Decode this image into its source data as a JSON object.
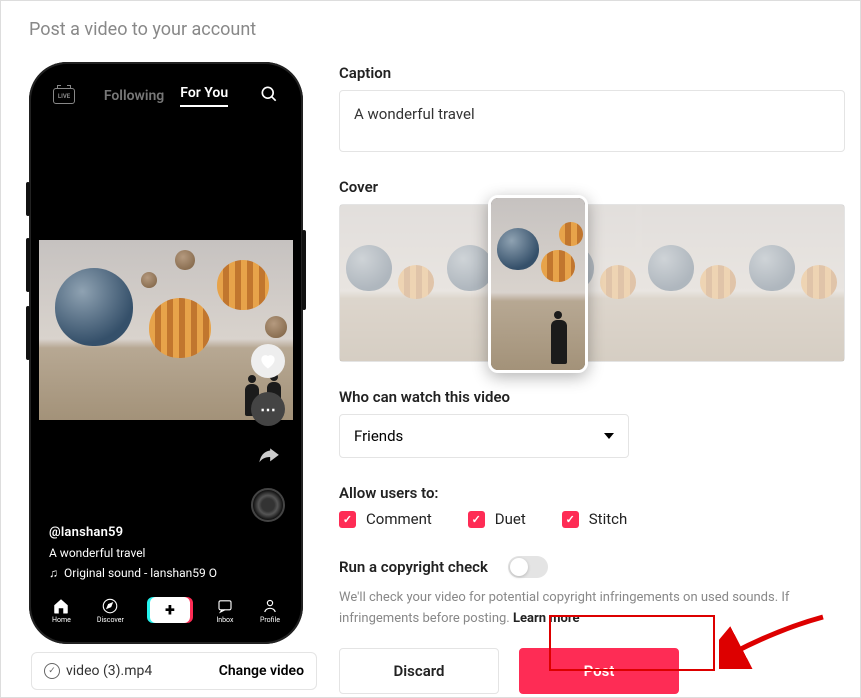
{
  "header": {
    "title": "Post a video to your account"
  },
  "phone": {
    "live_label": "LIVE",
    "tabs": {
      "following": "Following",
      "for_you": "For You"
    },
    "video": {
      "user": "@lanshan59",
      "caption": "A wonderful travel",
      "sound": "Original sound - lanshan59 O"
    },
    "nav": {
      "home": "Home",
      "discover": "Discover",
      "inbox": "Inbox",
      "profile": "Profile"
    }
  },
  "file": {
    "name": "video (3).mp4",
    "change": "Change video"
  },
  "form": {
    "caption_label": "Caption",
    "caption_value": "A wonderful travel",
    "cover_label": "Cover",
    "who_label": "Who can watch this video",
    "who_value": "Friends",
    "allow_label": "Allow users to:",
    "allow": {
      "comment": "Comment",
      "duet": "Duet",
      "stitch": "Stitch"
    },
    "copyright_label": "Run a copyright check",
    "help_text": "We'll check your video for potential copyright infringements on used sounds. If infringements before posting.",
    "learn_more": "Learn more",
    "discard": "Discard",
    "post": "Post"
  }
}
